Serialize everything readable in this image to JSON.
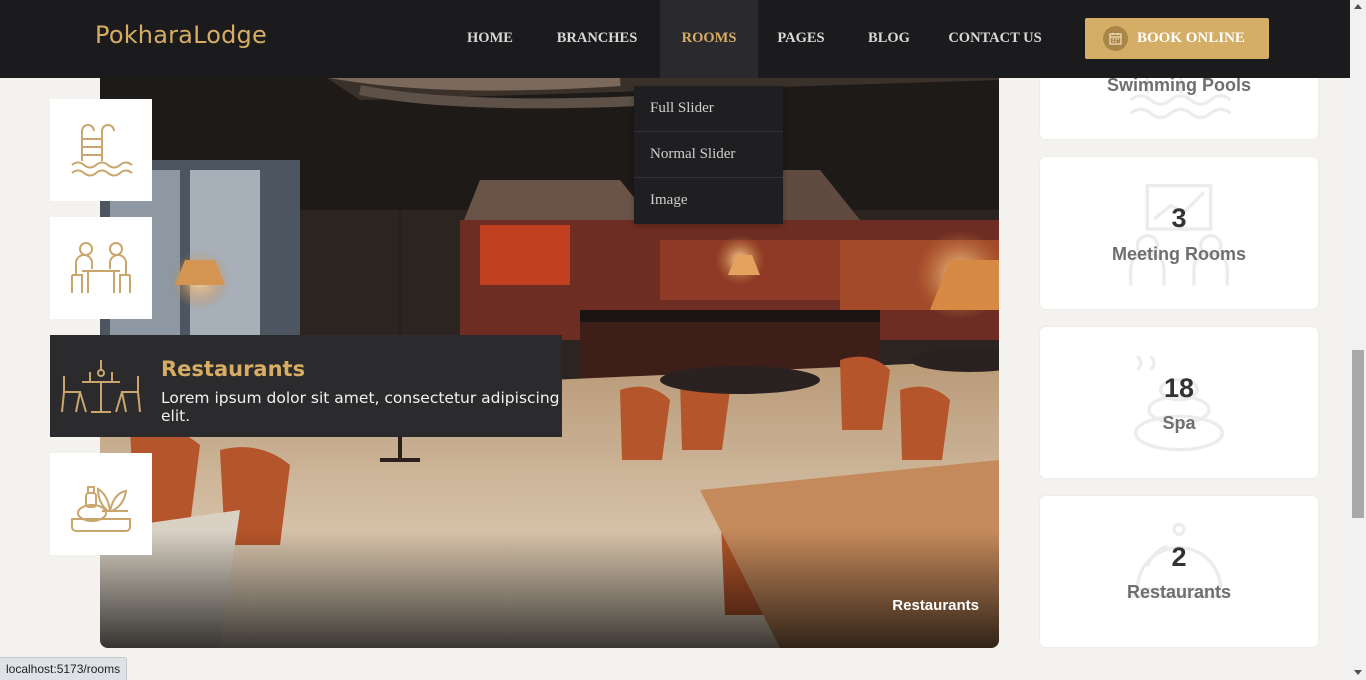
{
  "brand": {
    "name": "PokharaLodge"
  },
  "nav": {
    "items": [
      {
        "label": "HOME"
      },
      {
        "label": "BRANCHES"
      },
      {
        "label": "ROOMS"
      },
      {
        "label": "PAGES"
      },
      {
        "label": "BLOG"
      },
      {
        "label": "CONTACT US"
      }
    ],
    "active": "ROOMS",
    "book_button": "BOOK ONLINE"
  },
  "rooms_dropdown": {
    "items": [
      {
        "label": "Full Slider"
      },
      {
        "label": "Normal Slider"
      },
      {
        "label": "Image"
      }
    ]
  },
  "hero": {
    "caption": "Restaurants"
  },
  "features": {
    "tiles": [
      {
        "icon": "swimming-pool-icon"
      },
      {
        "icon": "meeting-room-icon"
      },
      {
        "icon": "restaurant-icon",
        "title": "Restaurants",
        "description": "Lorem ipsum dolor sit amet, consectetur adipiscing elit."
      },
      {
        "icon": "spa-icon"
      }
    ]
  },
  "stats": [
    {
      "label": "Swimming Pools",
      "icon": "swimming-pool-icon"
    },
    {
      "number": "3",
      "label": "Meeting Rooms",
      "icon": "meeting-room-icon"
    },
    {
      "number": "18",
      "label": "Spa",
      "icon": "spa-icon"
    },
    {
      "number": "2",
      "label": "Restaurants",
      "icon": "cloche-icon"
    }
  ],
  "status_bar": {
    "url": "localhost:5173/rooms"
  },
  "colors": {
    "accent": "#d6ad62",
    "nav_bg": "#1b1b1d",
    "page_bg": "#f4f2ee",
    "dark_tile": "#2b2b2d"
  }
}
